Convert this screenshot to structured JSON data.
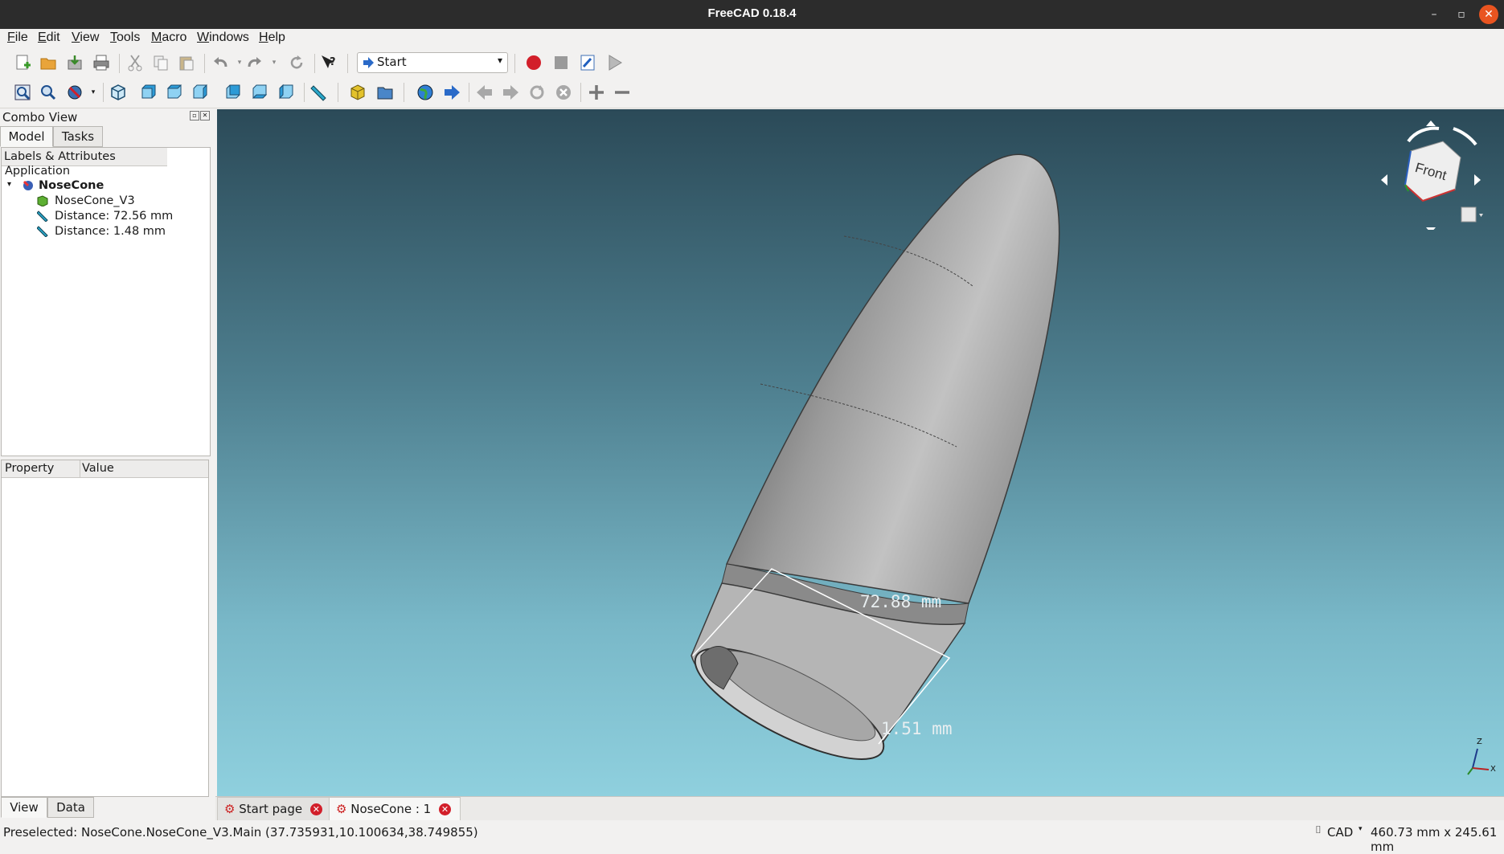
{
  "window": {
    "title": "FreeCAD 0.18.4",
    "minimize_icon": "–",
    "restore_icon": "▫",
    "close_icon": "✕"
  },
  "menu": [
    "File",
    "Edit",
    "View",
    "Tools",
    "Macro",
    "Windows",
    "Help"
  ],
  "workbench": {
    "selected": "Start",
    "arrow": "▾"
  },
  "combo_view": {
    "title": "Combo View",
    "tabs": [
      "Model",
      "Tasks"
    ],
    "header": "Labels & Attributes",
    "root": "Application",
    "document": "NoseCone",
    "children": [
      "NoseCone_V3",
      "Distance: 72.56 mm",
      "Distance: 1.48 mm"
    ]
  },
  "property_panel": {
    "columns": [
      "Property",
      "Value"
    ],
    "tabs": [
      "View",
      "Data"
    ]
  },
  "viewport": {
    "dim1": "72.88 mm",
    "dim2": "1.51 mm",
    "navcube_face": "Front",
    "axis_x": "X",
    "axis_z": "Z"
  },
  "doc_tabs": [
    {
      "label": "Start page"
    },
    {
      "label": "NoseCone : 1"
    }
  ],
  "status": {
    "left": "Preselected: NoseCone.NoseCone_V3.Main (37.735931,10.100634,38.749855)",
    "nav_style": "CAD",
    "dimensions": "460.73 mm x 245.61 mm"
  },
  "colors": {
    "accent_close": "#e95420",
    "record": "#d21f2a",
    "bg_top": "#2b4a58",
    "bg_bottom": "#8fd0de"
  }
}
